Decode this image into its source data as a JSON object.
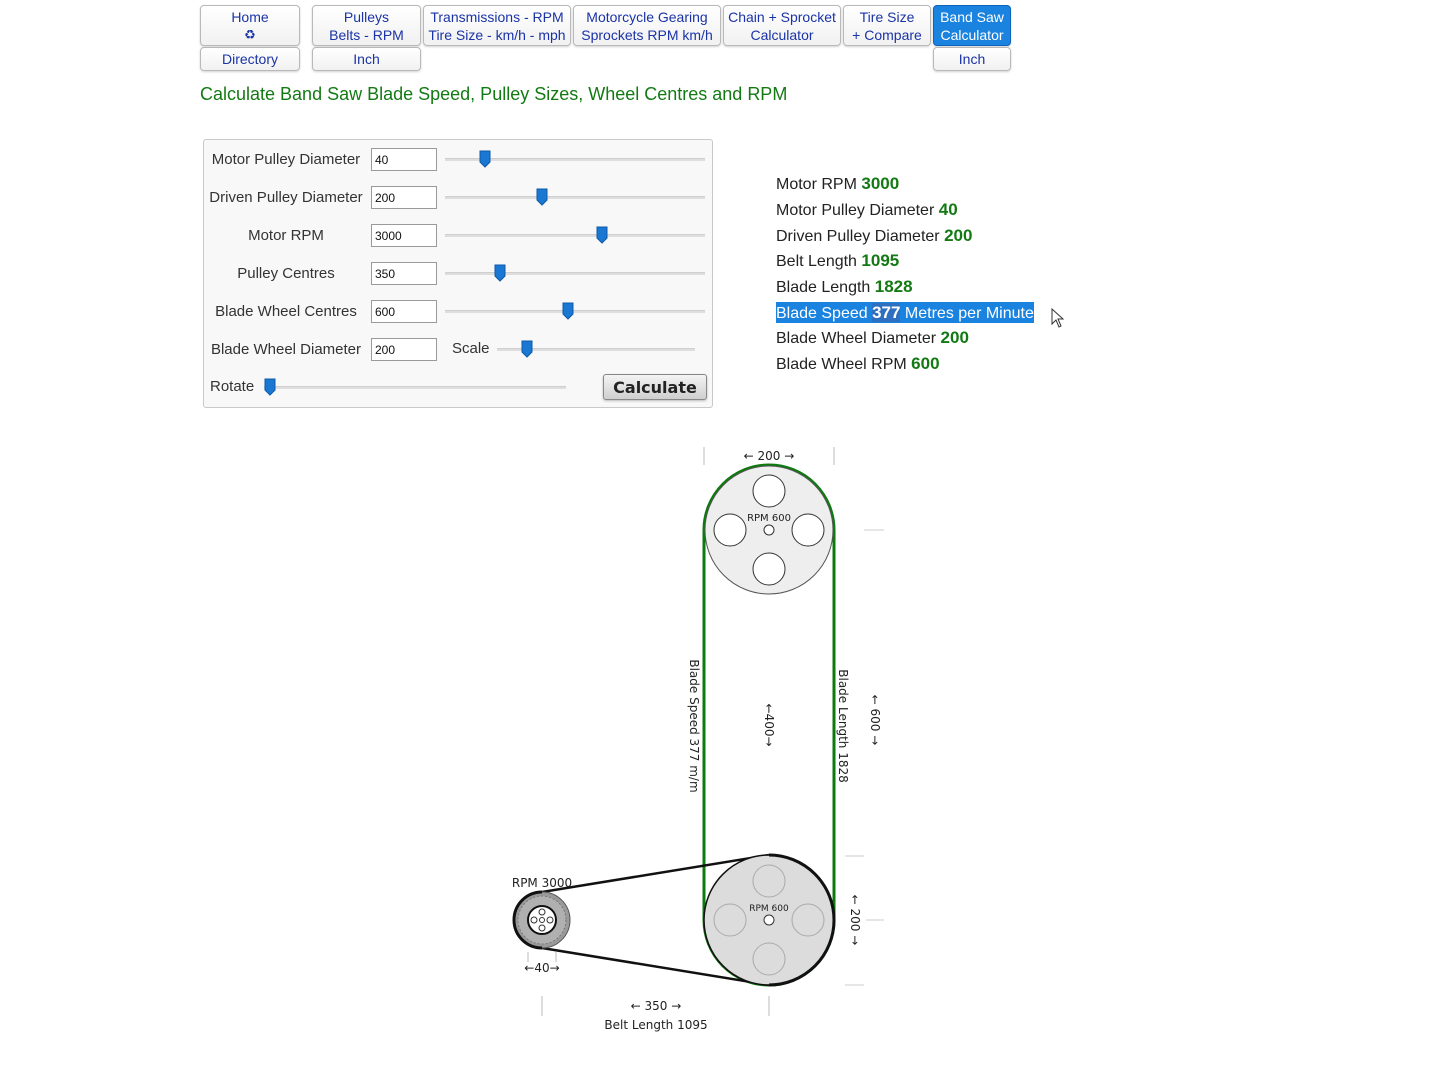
{
  "nav": {
    "home": {
      "line1": "Home",
      "icon": "♻"
    },
    "directory": "Directory",
    "pulleys": {
      "line1": "Pulleys",
      "line2": "Belts - RPM",
      "sub": "Inch"
    },
    "transmissions": {
      "line1": "Transmissions - RPM",
      "line2": "Tire Size - km/h - mph"
    },
    "motorcycle": {
      "line1": "Motorcycle Gearing",
      "line2": "Sprockets RPM km/h"
    },
    "chain": {
      "line1": "Chain + Sprocket",
      "line2": "Calculator"
    },
    "tire": {
      "line1": "Tire Size",
      "line2": "+ Compare"
    },
    "bandsaw": {
      "line1": "Band Saw",
      "line2": "Calculator",
      "sub": "Inch"
    }
  },
  "page_title": "Calculate Band Saw Blade Speed, Pulley Sizes, Wheel Centres and RPM",
  "form": {
    "rows": [
      {
        "label": "Motor Pulley Diameter",
        "value": "40",
        "slider": 0.13
      },
      {
        "label": "Driven Pulley Diameter",
        "value": "200",
        "slider": 0.35
      },
      {
        "label": "Motor RPM",
        "value": "3000",
        "slider": 0.58
      },
      {
        "label": "Pulley Centres",
        "value": "350",
        "slider": 0.19
      },
      {
        "label": "Blade Wheel Centres",
        "value": "600",
        "slider": 0.45
      },
      {
        "label": "Blade Wheel Diameter",
        "value": "200"
      }
    ],
    "scale_label": "Scale",
    "scale_slider": 0.12,
    "rotate_label": "Rotate",
    "rotate_slider": 0.0,
    "calculate_label": "Calculate"
  },
  "results": {
    "motor_rpm": {
      "label": "Motor RPM",
      "value": "3000"
    },
    "motor_pulley": {
      "label": "Motor Pulley Diameter",
      "value": "40"
    },
    "driven_pulley": {
      "label": "Driven Pulley Diameter",
      "value": "200"
    },
    "belt_length": {
      "label": "Belt Length",
      "value": "1095"
    },
    "blade_length": {
      "label": "Blade Length",
      "value": "1828"
    },
    "blade_speed": {
      "label": "Blade Speed",
      "value": "377",
      "unit": "Metres per Minute"
    },
    "blade_wheel_dia": {
      "label": "Blade Wheel Diameter",
      "value": "200"
    },
    "blade_wheel_rpm": {
      "label": "Blade Wheel RPM",
      "value": "600"
    }
  },
  "diagram": {
    "top_width": "← 200 →",
    "top_rpm": "RPM 600",
    "bottom_rpm": "RPM 600",
    "motor_rpm": "RPM 3000",
    "motor_dia": "←40→",
    "centre_dim": "←400→",
    "wheel_centres": "← 600 →",
    "bottom_dia": "← 200 →",
    "blade_speed": "Blade Speed 377 m/m",
    "blade_length": "Blade Length 1828",
    "pulley_centres": "← 350 →",
    "belt_length": "Belt Length 1095",
    "colors": {
      "blade": "#0d7a0d",
      "belt": "#111111",
      "wheel": "#eeeeee"
    }
  },
  "colors": {
    "accent": "#1a83e0",
    "nav_text": "#1a33a6",
    "title": "#137a13"
  }
}
